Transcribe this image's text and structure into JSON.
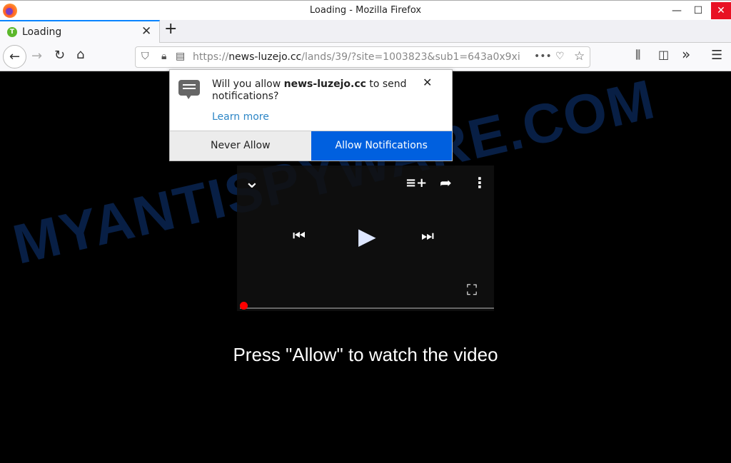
{
  "window": {
    "title": "Loading - Mozilla Firefox",
    "minimize": "—",
    "maximize": "☐",
    "close": "✕"
  },
  "tab": {
    "label": "Loading",
    "favicon": "T",
    "close": "✕",
    "new_tab": "+"
  },
  "nav": {
    "back": "←",
    "forward": "→",
    "reload": "↻",
    "home": "⌂",
    "url_host": "news-luzejo.cc",
    "url_prefix": "https://",
    "url_rest": "/lands/39/?site=1003823&sub1=643a0x9xi",
    "more": "•••",
    "pocket": "♡",
    "star": "☆",
    "library": "⫼",
    "sidebar": "◫",
    "overflow": "»",
    "menu": "☰"
  },
  "popup": {
    "msg_pre": "Will you allow ",
    "msg_host": "news-luzejo.cc",
    "msg_post": " to send notifications?",
    "learn_more": "Learn more",
    "close": "✕",
    "never_allow": "Never Allow",
    "allow": "Allow Notifications"
  },
  "watermark": "MYANTISPYWARE.COM",
  "player": {
    "collapse": "⌄",
    "add_queue": "≡+",
    "share": "➦",
    "more": "⋮",
    "prev": "⏮",
    "play": "▶",
    "next": "⏭",
    "fullscreen": "⛶",
    "progress": 0
  },
  "cta": "Press \"Allow\" to watch the video"
}
